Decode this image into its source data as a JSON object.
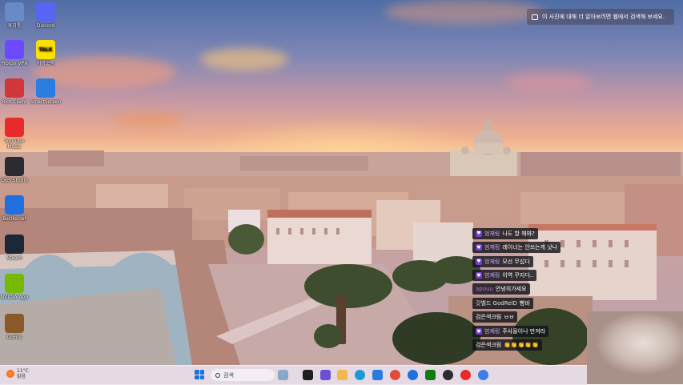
{
  "desktop": {
    "icons": [
      {
        "label": "휴지통",
        "icon": "recycle-bin-icon",
        "color": "#6a89c6"
      },
      {
        "label": "Discord",
        "icon": "discord-icon",
        "color": "#5865f2"
      },
      {
        "label": "Proton VPN",
        "icon": "protonvpn-icon",
        "color": "#6d4aff"
      },
      {
        "label": "카카오톡",
        "icon": "kakaotalk-icon",
        "color": "#fae100",
        "glyph": "TALK"
      },
      {
        "label": "Riot Client",
        "icon": "riot-client-icon",
        "color": "#d13639"
      },
      {
        "label": "SmartScreen",
        "icon": "windows-app-icon",
        "color": "#2b7de0"
      },
      {
        "label": "YouTube Music",
        "icon": "youtube-music-icon",
        "color": "#e82a2a"
      },
      {
        "label": "OBS Studio",
        "icon": "obs-studio-icon",
        "color": "#2b2b30"
      },
      {
        "label": "Battle.net",
        "icon": "battlenet-icon",
        "color": "#1f6fe0"
      },
      {
        "label": "Steam",
        "icon": "steam-icon",
        "color": "#1b2838"
      },
      {
        "label": "NVIDIA App",
        "icon": "nvidia-icon",
        "color": "#76b900"
      },
      {
        "label": "GoFire",
        "icon": "game-app-icon",
        "color": "#8a5a2b"
      }
    ]
  },
  "search_hint": {
    "text": "이 사진에 대해 더 알아보려면 웹에서 검색해 보세요."
  },
  "chat": {
    "messages": [
      {
        "user": "범재링",
        "text": "나도 할 해봐?",
        "badge": true,
        "user_color": "#c8a8ff"
      },
      {
        "user": "범재링",
        "text": "레이너는 안쓰는게 낫나",
        "badge": true,
        "user_color": "#c8a8ff"
      },
      {
        "user": "범재링",
        "text": "모선 무섭다",
        "badge": true,
        "user_color": "#c8a8ff"
      },
      {
        "user": "범재링",
        "text": "이역 꾸지다..",
        "badge": true,
        "user_color": "#c8a8ff"
      },
      {
        "user": "apouu",
        "text": "안녕히가세요",
        "badge": false,
        "user_color": "#b070d0"
      },
      {
        "user": "갓벨드 GodRelD",
        "text": "빵바",
        "badge": false,
        "user_color": "#e0e0e0"
      },
      {
        "user": "검은색크림",
        "text": "ㅂㅂ",
        "badge": false,
        "user_color": "#ffffff"
      },
      {
        "user": "범재링",
        "text": "주사율이나 만져라",
        "badge": true,
        "user_color": "#c8a8ff"
      },
      {
        "user": "검은색크림",
        "text": "👏👏👏👏👏",
        "badge": false,
        "user_color": "#ffffff"
      }
    ]
  },
  "taskbar": {
    "weather": {
      "temp": "11°C",
      "condition": "맑음"
    },
    "search_placeholder": "검색",
    "apps": [
      {
        "icon": "copilot-icon",
        "color": "#8aa6c8"
      },
      {
        "icon": "file-explorer-icon",
        "color": "#1f1f1f"
      },
      {
        "icon": "widgets-icon",
        "color": "#6b4fd6"
      },
      {
        "icon": "folder-icon",
        "color": "#f2b84b"
      },
      {
        "icon": "edge-icon",
        "color": "#1a9ad6"
      },
      {
        "icon": "store-icon",
        "color": "#2a7be0"
      },
      {
        "icon": "chrome-icon",
        "color": "#e04b3a"
      },
      {
        "icon": "battlenet-icon",
        "color": "#1f6fe0"
      },
      {
        "icon": "xbox-icon",
        "color": "#107c10"
      },
      {
        "icon": "obs-studio-icon",
        "color": "#2b2b30"
      },
      {
        "icon": "youtube-music-icon",
        "color": "#e82a2a"
      },
      {
        "icon": "battlenet-icon",
        "color": "#3a7ee8"
      }
    ]
  }
}
